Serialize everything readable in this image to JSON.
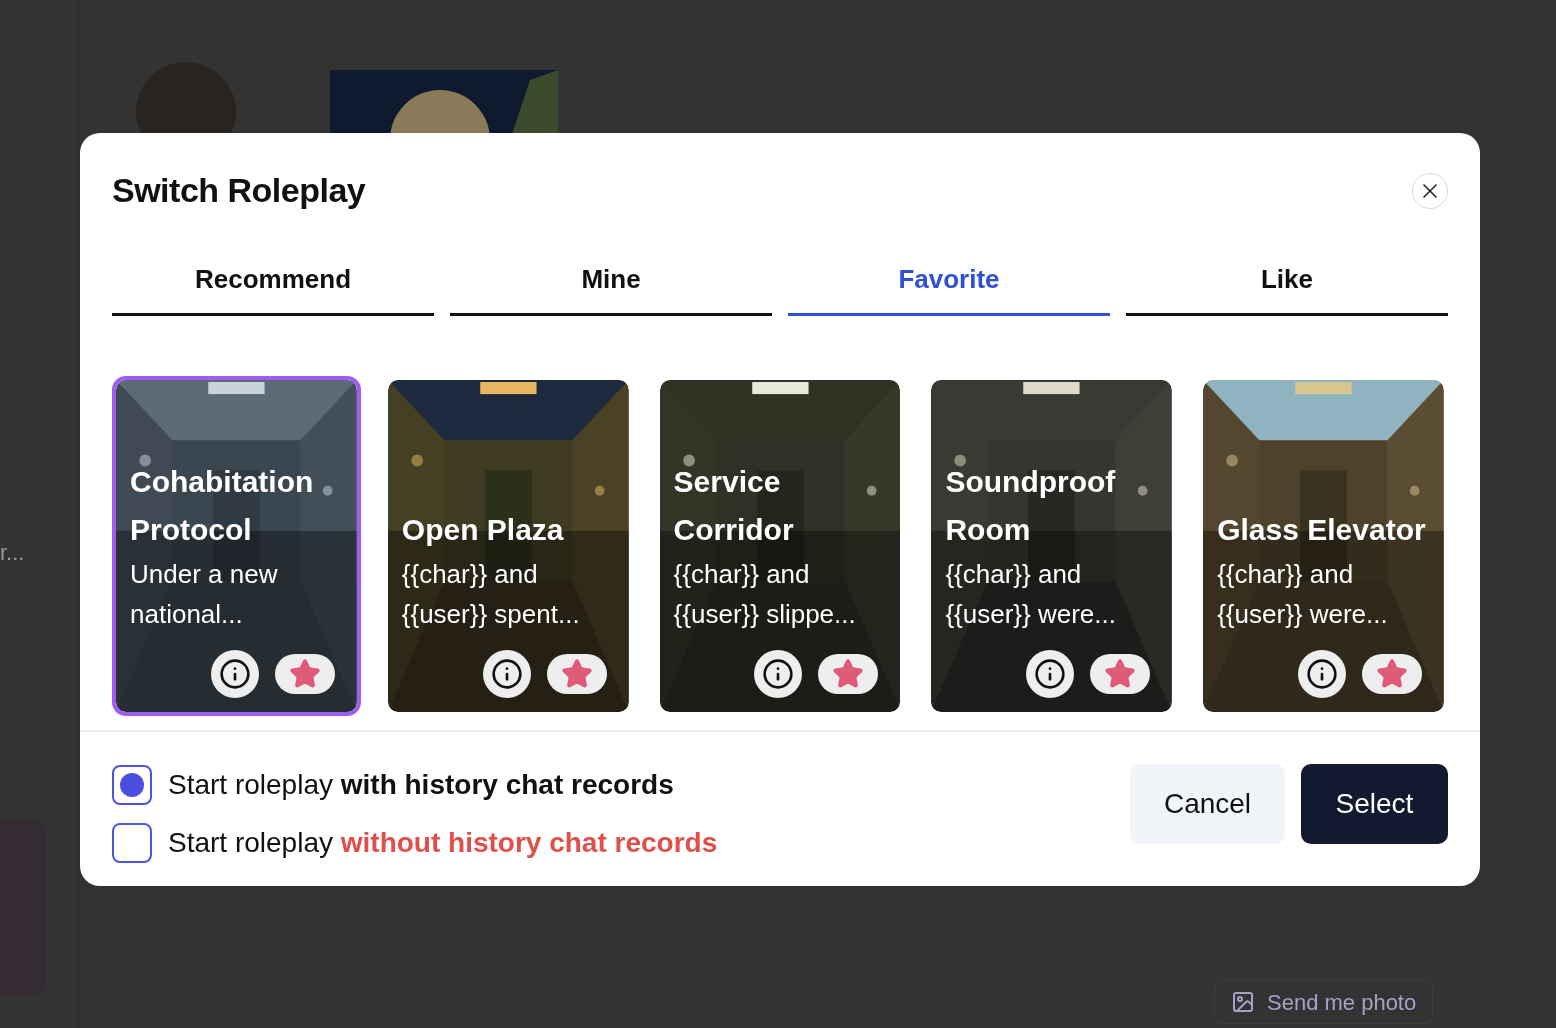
{
  "background": {
    "side_text": "r...",
    "photo_button": "Send me photo"
  },
  "dialog": {
    "title": "Switch Roleplay",
    "tabs": [
      {
        "label": "Recommend",
        "selected": false
      },
      {
        "label": "Mine",
        "selected": false
      },
      {
        "label": "Favorite",
        "selected": true
      },
      {
        "label": "Like",
        "selected": false
      }
    ],
    "cards": [
      {
        "title": "Cohabitation Protocol",
        "description": "Under a new national...",
        "selected": true,
        "favorited": true
      },
      {
        "title": "Open Plaza",
        "description": "{{char}} and {{user}} spent...",
        "selected": false,
        "favorited": true
      },
      {
        "title": "Service Corridor",
        "description": "{{char}} and {{user}} slippe...",
        "selected": false,
        "favorited": true
      },
      {
        "title": "Soundproof Room",
        "description": "{{char}} and {{user}} were...",
        "selected": false,
        "favorited": true
      },
      {
        "title": "Glass Elevator",
        "description": "{{char}} and {{user}} were...",
        "selected": false,
        "favorited": true
      }
    ],
    "options": [
      {
        "prefix": "Start roleplay",
        "emphasis": "with history chat records",
        "kind": "bold",
        "selected": true
      },
      {
        "prefix": "Start roleplay",
        "emphasis": "without history chat records",
        "kind": "warning",
        "selected": false
      }
    ],
    "buttons": {
      "cancel": "Cancel",
      "confirm": "Select"
    }
  }
}
